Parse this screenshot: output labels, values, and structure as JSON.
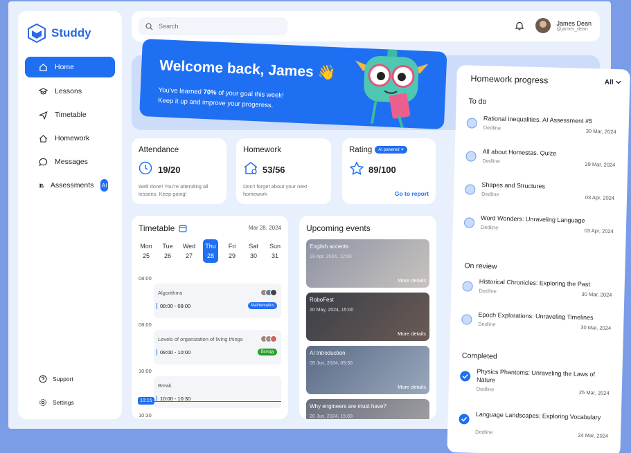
{
  "app": {
    "name": "Studdy"
  },
  "sidebar": {
    "items": [
      {
        "label": "Home",
        "icon": "home-icon",
        "active": true
      },
      {
        "label": "Lessons",
        "icon": "graduation-cap-icon"
      },
      {
        "label": "Timetable",
        "icon": "send-icon"
      },
      {
        "label": "Homework",
        "icon": "house-icon"
      },
      {
        "label": "Messages",
        "icon": "chat-icon"
      },
      {
        "label": "Assessments",
        "icon": "books-icon",
        "badge": "AI"
      }
    ],
    "footer": [
      {
        "label": "Support",
        "icon": "help-icon"
      },
      {
        "label": "Settings",
        "icon": "gear-icon"
      }
    ]
  },
  "header": {
    "search_placeholder": "Search",
    "user": {
      "name": "James Dean",
      "handle": "@james_dean"
    }
  },
  "banner": {
    "title": "Welcome back, James 👋",
    "line1_prefix": "You've learned ",
    "line1_strong": "70%",
    "line1_suffix": " of your goal this week!",
    "line2": "Keep it up and improve your progeress."
  },
  "stats": {
    "attendance": {
      "title": "Attendance",
      "value": "19/20",
      "note": "Well done! You're attending all lessons. Keep going!"
    },
    "homework": {
      "title": "Homework",
      "value": "53/56",
      "note": "Don't forget about your next homework"
    },
    "rating": {
      "title": "Rating",
      "badge": "AI powered ✦",
      "value": "89/100",
      "link": "Go to report"
    }
  },
  "timetable": {
    "title": "Timetable",
    "date": "Mar 28, 2024",
    "days": [
      {
        "name": "Mon",
        "num": "25"
      },
      {
        "name": "Tue",
        "num": "26"
      },
      {
        "name": "Wed",
        "num": "27"
      },
      {
        "name": "Thu",
        "num": "28",
        "active": true
      },
      {
        "name": "Fri",
        "num": "29"
      },
      {
        "name": "Sat",
        "num": "30"
      },
      {
        "name": "Sun",
        "num": "31"
      }
    ],
    "times": [
      "08:00",
      "08:00",
      "10:00",
      "10:30"
    ],
    "now": "10:15",
    "slots": [
      {
        "title": "Algorithms",
        "range": "08:00 - 08:00",
        "tag": "Mathematics",
        "tag_color": "#1f6ff2"
      },
      {
        "title": "Levels of organization of living things",
        "range": "09:00 - 10:00",
        "tag": "Biology",
        "tag_color": "#22a122"
      },
      {
        "title": "Break",
        "range": "10:00 - 10:30"
      }
    ]
  },
  "events": {
    "title": "Upcoming events",
    "more": "More details",
    "items": [
      {
        "name": "English accents",
        "date": "18 Apr, 2024, 12:00"
      },
      {
        "name": "RoboFest",
        "date": "20 May, 2024, 15:00"
      },
      {
        "name": "AI Introduction",
        "date": "09 Jun, 2024, 09:30"
      },
      {
        "name": "Why engineers are must have?",
        "date": "20 Jun, 2024, 15:00"
      }
    ]
  },
  "homework_progress": {
    "title": "Homework progress",
    "filter": "All",
    "deadline_label": "Dedline",
    "sections": {
      "todo": "To do",
      "review": "On review",
      "completed": "Completed"
    },
    "todo": [
      {
        "name": "Rational inequalities. AI Assessment #5",
        "date": "30 Mar, 2024"
      },
      {
        "name": "All about Homestas. Quize",
        "date": "29 Mar, 2024"
      },
      {
        "name": "Shapes and Structures",
        "date": "03 Apr, 2024"
      },
      {
        "name": "Word Wonders: Unraveling Language",
        "date": "03 Apr, 2024"
      }
    ],
    "review": [
      {
        "name": "Historical Chronicles: Exploring the Past",
        "date": "30 Mar, 2024"
      },
      {
        "name": "Epoch Explorations: Unraveling Timelines",
        "date": "30 Mar, 2024"
      }
    ],
    "completed": [
      {
        "name": "Physics Phantoms: Unraveling the Laws of Nature",
        "date": "25 Mar, 2024"
      },
      {
        "name": "Language Landscapes: Exploring Vocabulary",
        "date": "24 Mar, 2024"
      }
    ]
  },
  "colors": {
    "accent": "#1f6ff2",
    "background": "#7b9de8"
  }
}
